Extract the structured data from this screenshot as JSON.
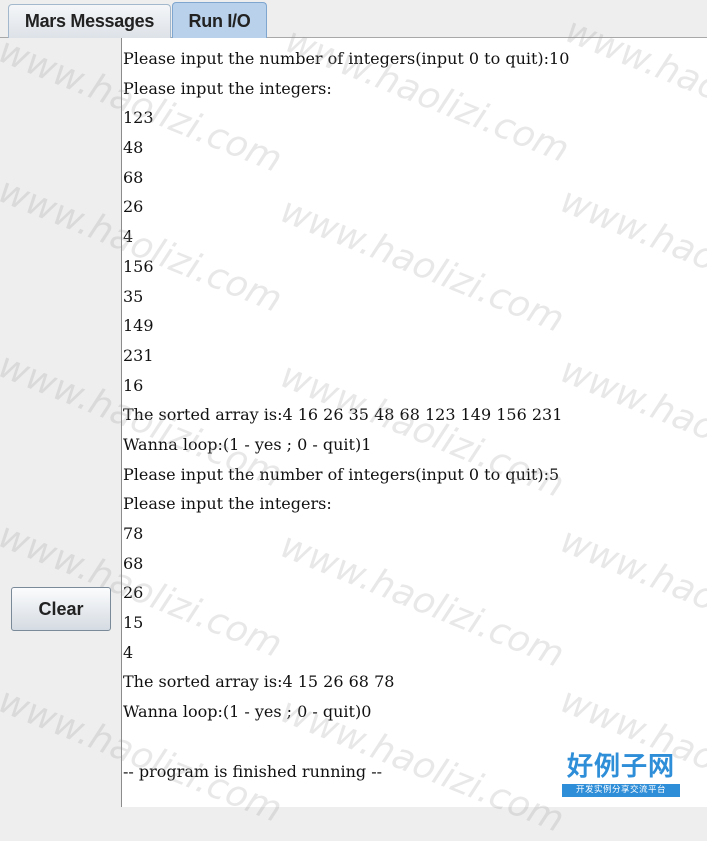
{
  "tabs": [
    {
      "label": "Mars Messages",
      "selected": false
    },
    {
      "label": "Run I/O",
      "selected": true
    }
  ],
  "actions": {
    "clear_label": "Clear"
  },
  "console": {
    "lines": [
      "Please input the number of integers(input 0 to quit):10",
      "Please input the integers:",
      "123",
      "48",
      "68",
      "26",
      "4",
      "156",
      "35",
      "149",
      "231",
      "16",
      "The sorted array is:4 16 26 35 48 68 123 149 156 231",
      "Wanna loop:(1 - yes ; 0 - quit)1",
      "Please input the number of integers(input 0 to quit):5",
      "Please input the integers:",
      "78",
      "68",
      "26",
      "15",
      "4",
      "The sorted array is:4 15 26 68 78",
      "Wanna loop:(1 - yes ; 0 - quit)0"
    ],
    "finish_line": "-- program is finished running --"
  },
  "watermark": {
    "text": "www.haolizi.com",
    "logo_main": "好例子网",
    "logo_sub": "开发实例分享交流平台"
  },
  "colors": {
    "selected_tab": "#b9d1ea",
    "logo_blue": "#2f8ed8"
  }
}
